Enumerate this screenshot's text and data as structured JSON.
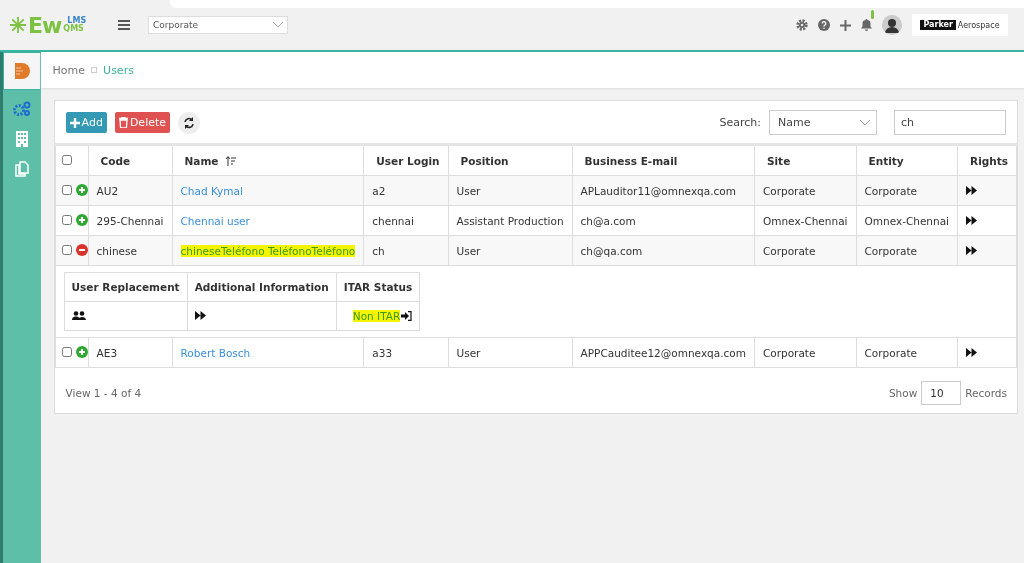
{
  "topbar": {
    "logo_main": "Ew",
    "logo_top": "LMS",
    "logo_bottom": "QMS",
    "site_select": "Corporate",
    "notification_dot": true,
    "company_logo_text": "Parker",
    "company_logo_sub": "Aerospace"
  },
  "sidebar": {
    "items": [
      {
        "kind": "document",
        "selected": true
      },
      {
        "kind": "gears",
        "selected": false
      },
      {
        "kind": "building",
        "selected": false
      },
      {
        "kind": "copy",
        "selected": false
      }
    ]
  },
  "breadcrumb": [
    "Home",
    "Users"
  ],
  "toolbar": {
    "add": "Add",
    "delete": "Delete",
    "search_label": "Search:",
    "search_field": "Name",
    "search_value": "ch"
  },
  "table": {
    "all_checked": false,
    "columns": [
      {
        "label": "Code",
        "sorted": false
      },
      {
        "label": "Name",
        "sorted": true
      },
      {
        "label": "User Login",
        "sorted": false
      },
      {
        "label": "Position",
        "sorted": false
      },
      {
        "label": "Business E-mail",
        "sorted": false
      },
      {
        "label": "Site",
        "sorted": false
      },
      {
        "label": "Entity",
        "sorted": false
      },
      {
        "label": "Rights",
        "sorted": false
      }
    ],
    "rows": [
      {
        "checked": false,
        "expanded": false,
        "highlighted": false,
        "cells": [
          "AU2",
          "Chad Kymal",
          "a2",
          "User",
          "APLauditor11@omnexqa.com",
          "Corporate",
          "Corporate"
        ]
      },
      {
        "checked": false,
        "expanded": false,
        "highlighted": false,
        "cells": [
          "295-Chennai",
          "Chennai user",
          "chennai",
          "Assistant Production",
          "ch@a.com",
          "Omnex-Chennai",
          "Omnex-Chennai"
        ]
      },
      {
        "checked": false,
        "expanded": true,
        "highlighted": true,
        "cells": [
          "chinese",
          "chineseTeléfono TeléfonoTeléfono",
          "ch",
          "User",
          "ch@qa.com",
          "Corporate",
          "Corporate"
        ],
        "detail": {
          "columns": [
            "User Replacement",
            "Additional Information",
            "ITAR Status"
          ],
          "itar_status": "Non ITAR",
          "itar_highlighted": true
        }
      },
      {
        "checked": false,
        "expanded": false,
        "highlighted": false,
        "cells": [
          "AE3",
          "Robert Bosch",
          "a33",
          "User",
          "APPCauditee12@omnexqa.com",
          "Corporate",
          "Corporate"
        ]
      }
    ]
  },
  "footer": {
    "summary": "View 1 - 4 of 4",
    "show_label": "Show",
    "page_size": "10",
    "records_label": "Records"
  }
}
